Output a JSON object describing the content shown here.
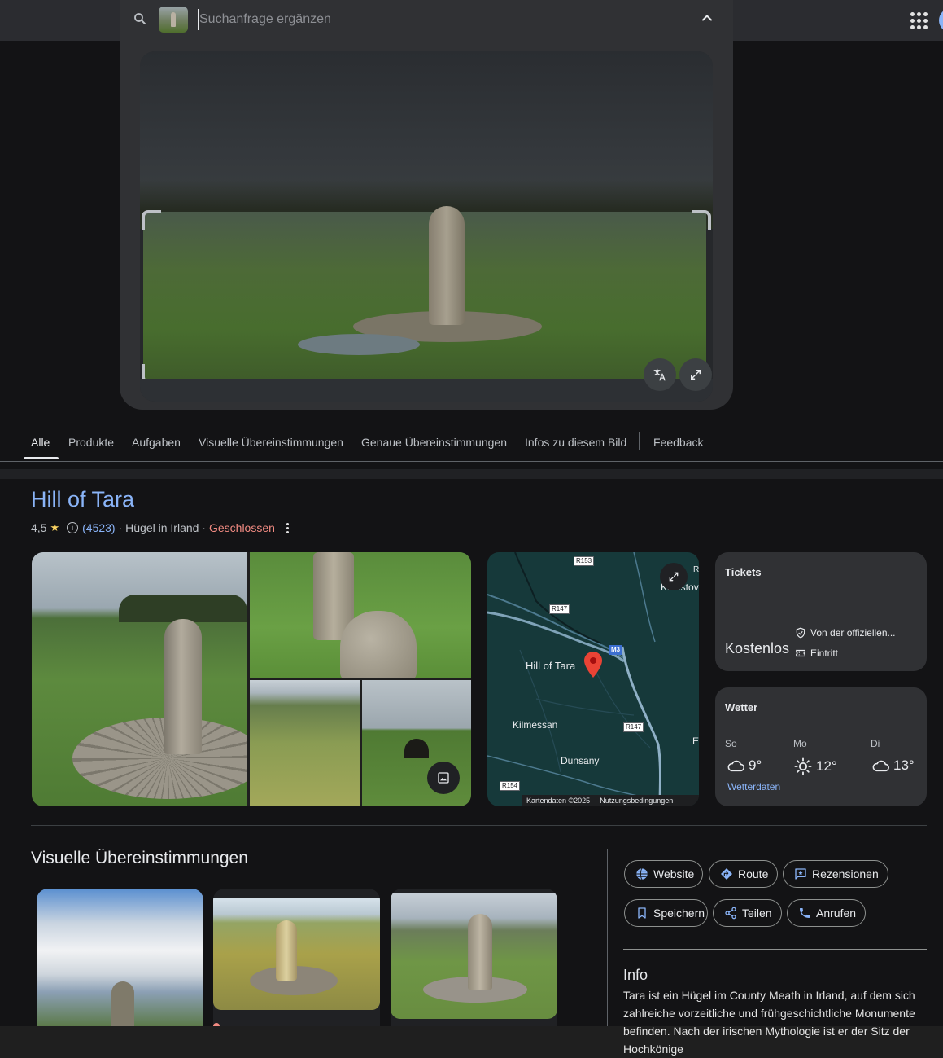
{
  "search": {
    "placeholder": "Suchanfrage ergänzen"
  },
  "tabs": [
    {
      "label": "Alle",
      "active": true
    },
    {
      "label": "Produkte"
    },
    {
      "label": "Aufgaben"
    },
    {
      "label": "Visuelle Übereinstimmungen"
    },
    {
      "label": "Genaue Übereinstimmungen"
    },
    {
      "label": "Infos zu diesem Bild"
    },
    {
      "label": "Feedback"
    }
  ],
  "place": {
    "title": "Hill of Tara",
    "rating": "4,5",
    "review_count": "(4523)",
    "type": "· Hügel in Irland ·",
    "status": "Geschlossen"
  },
  "map": {
    "place_label": "Hill of Tara",
    "labels": {
      "kentstown": "Kentstov",
      "kilmessan": "Kilmessan",
      "dunsany": "Dunsany",
      "edge_r": "R",
      "edge_e": "E"
    },
    "roads": {
      "r153": "R153",
      "r147_a": "R147",
      "m3": "M3",
      "r147_b": "R147",
      "r154": "R154"
    },
    "footer_data": "Kartendaten ©2025",
    "footer_terms": "Nutzungsbedingungen"
  },
  "tickets": {
    "title": "Tickets",
    "price": "Kostenlos",
    "official": "Von der offiziellen...",
    "entry": "Eintritt"
  },
  "weather": {
    "title": "Wetter",
    "days": [
      {
        "day": "So",
        "temp": "9°",
        "icon": "cloud-icon"
      },
      {
        "day": "Mo",
        "temp": "12°",
        "icon": "sun-icon"
      },
      {
        "day": "Di",
        "temp": "13°",
        "icon": "cloud-icon"
      }
    ],
    "link": "Wetterdaten"
  },
  "visual_matches": {
    "title": "Visuelle Übereinstimmungen"
  },
  "actions": {
    "website": "Website",
    "route": "Route",
    "reviews": "Rezensionen",
    "save": "Speichern",
    "share": "Teilen",
    "call": "Anrufen"
  },
  "info": {
    "title": "Info",
    "text": "Tara ist ein Hügel im County Meath in Irland, auf dem sich zahlreiche vorzeitliche und frühgeschichtliche Monumente befinden. Nach der irischen Mythologie ist er der Sitz der Hochkönige"
  },
  "colors": {
    "link_blue": "#8ab4f8",
    "closed_red": "#f28b82",
    "star_yellow": "#fdd663",
    "pin_red": "#ea4335",
    "card_bg": "#303134",
    "page_bg": "#131315"
  }
}
